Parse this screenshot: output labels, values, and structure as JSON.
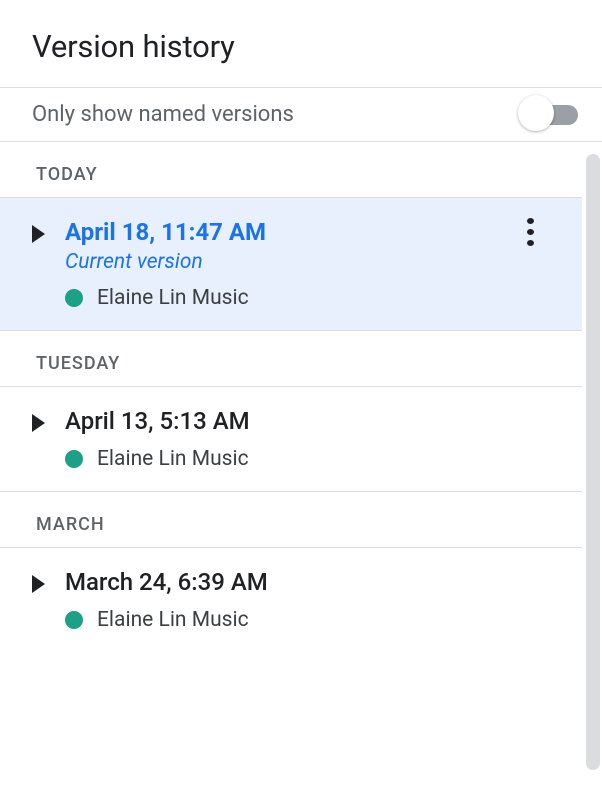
{
  "panel": {
    "title": "Version history"
  },
  "filter": {
    "label": "Only show named versions",
    "enabled": false
  },
  "groups": [
    {
      "label": "TODAY",
      "entries": [
        {
          "title": "April 18, 11:47 AM",
          "subtitle": "Current version",
          "author": "Elaine Lin Music",
          "authorColor": "#1ca086",
          "selected": true,
          "hasMenu": true
        }
      ]
    },
    {
      "label": "TUESDAY",
      "entries": [
        {
          "title": "April 13, 5:13 AM",
          "subtitle": "",
          "author": "Elaine Lin Music",
          "authorColor": "#1ca086",
          "selected": false,
          "hasMenu": false
        }
      ]
    },
    {
      "label": "MARCH",
      "entries": [
        {
          "title": "March 24, 6:39 AM",
          "subtitle": "",
          "author": "Elaine Lin Music",
          "authorColor": "#1ca086",
          "selected": false,
          "hasMenu": false
        }
      ]
    }
  ]
}
